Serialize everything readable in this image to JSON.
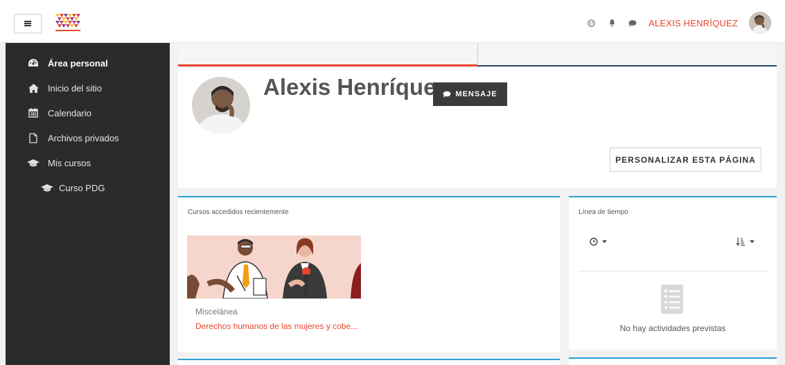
{
  "navbar": {
    "user_name": "ALEXIS HENRÍQUEZ",
    "icons": [
      "globe-icon",
      "bell-icon",
      "chat-icon"
    ]
  },
  "sidebar": {
    "items": [
      {
        "label": "Área personal",
        "icon": "dashboard-icon"
      },
      {
        "label": "Inicio del sitio",
        "icon": "home-icon"
      },
      {
        "label": "Calendario",
        "icon": "calendar-icon"
      },
      {
        "label": "Archivos privados",
        "icon": "file-icon"
      },
      {
        "label": "Mis cursos",
        "icon": "graduation-cap-icon"
      },
      {
        "label": "Curso PDG",
        "icon": "graduation-cap-icon"
      }
    ]
  },
  "profile": {
    "name": "Alexis Henríquez",
    "message_button": "MENSAJE",
    "customize_button": "PERSONALIZAR ESTA PÁGINA"
  },
  "recent_courses": {
    "title": "Cursos accedidos recientemente",
    "course": {
      "category": "Miscelánea",
      "name": "Derechos humanos de las mujeres y cobe..."
    }
  },
  "timeline": {
    "title": "Línea de tiempo",
    "empty_text": "No hay actividades previstas"
  },
  "colors": {
    "accent": "#e8452e",
    "sidebar_bg": "#2b2b2b",
    "card_border": "#2a9fd6",
    "tab_line_right": "#244a6b"
  }
}
